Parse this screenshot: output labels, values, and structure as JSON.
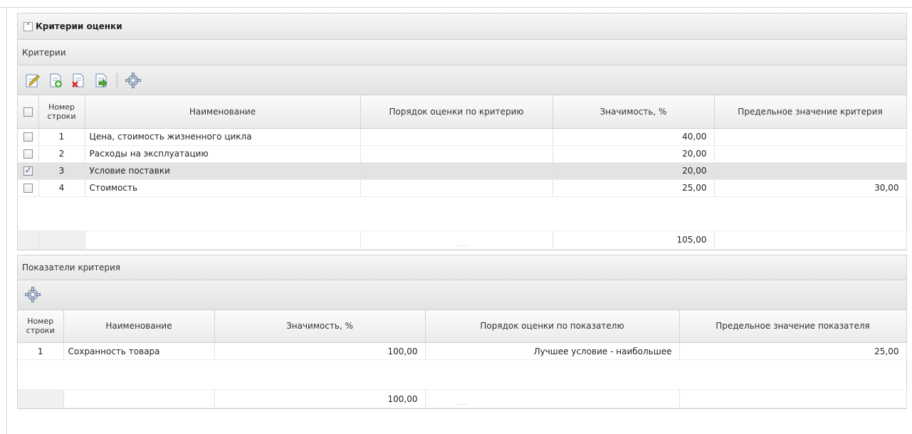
{
  "section": {
    "title": "Критерии оценки",
    "collapse_icon": "double-chevron-up-icon"
  },
  "criteria": {
    "panel_title": "Критерии",
    "toolbar": [
      {
        "name": "edit-button",
        "icon": "edit-icon"
      },
      {
        "name": "add-button",
        "icon": "add-document-icon"
      },
      {
        "name": "delete-button",
        "icon": "delete-document-icon"
      },
      {
        "name": "export-button",
        "icon": "export-document-icon"
      },
      {
        "name": "settings-button",
        "icon": "gear-icon"
      }
    ],
    "columns": [
      "Номер строки",
      "Наименование",
      "Порядок оценки по критерию",
      "Значимость, %",
      "Предельное значение критерия"
    ],
    "rows": [
      {
        "checked": false,
        "num": "1",
        "name": "Цена, стоимость жизненного цикла",
        "order": "",
        "weight": "40,00",
        "limit": ""
      },
      {
        "checked": false,
        "num": "2",
        "name": "Расходы на эксплуатацию",
        "order": "",
        "weight": "20,00",
        "limit": ""
      },
      {
        "checked": true,
        "num": "3",
        "name": "Условие поставки",
        "order": "",
        "weight": "20,00",
        "limit": ""
      },
      {
        "checked": false,
        "num": "4",
        "name": "Стоимость",
        "order": "",
        "weight": "25,00",
        "limit": "30,00"
      }
    ],
    "total_weight": "105,00",
    "resize_grip": "...."
  },
  "indicators": {
    "panel_title": "Показатели критерия",
    "toolbar": [
      {
        "name": "settings-button",
        "icon": "gear-icon"
      }
    ],
    "columns": [
      "Номер строки",
      "Наименование",
      "Значимость, %",
      "Порядок оценки по показателю",
      "Предельное значение показателя"
    ],
    "rows": [
      {
        "num": "1",
        "name": "Сохранность товара",
        "weight": "100,00",
        "order": "Лучшее условие - наибольшее",
        "limit": "25,00"
      }
    ],
    "total_weight": "100,00",
    "resize_grip": "...."
  }
}
